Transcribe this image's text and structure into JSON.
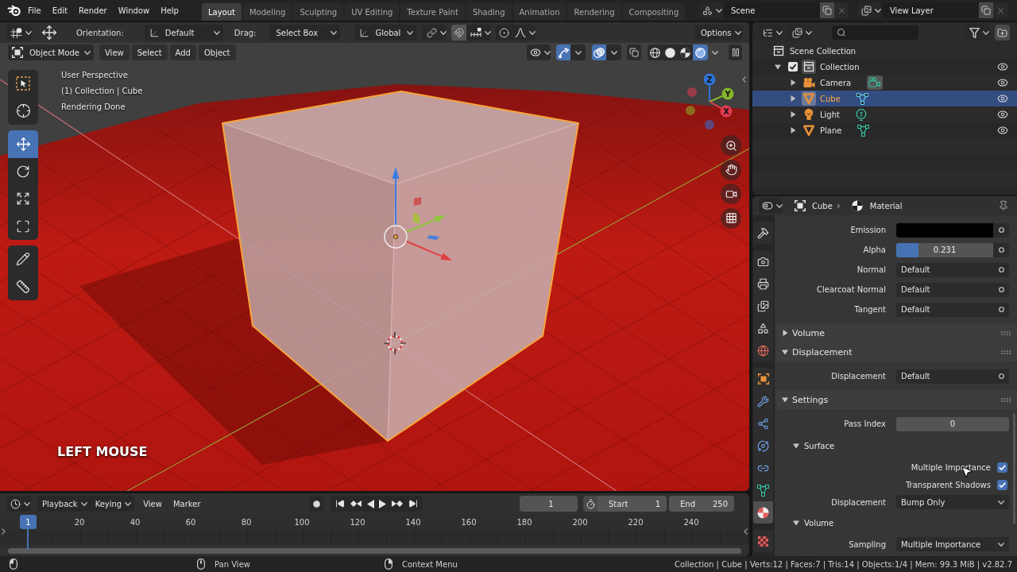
{
  "menubar": {
    "items": [
      "File",
      "Edit",
      "Render",
      "Window",
      "Help"
    ]
  },
  "workspaces": [
    {
      "label": "Layout",
      "selected": true
    },
    {
      "label": "Modeling",
      "selected": false
    },
    {
      "label": "Sculpting",
      "selected": false
    },
    {
      "label": "UV Editing",
      "selected": false
    },
    {
      "label": "Texture Paint",
      "selected": false
    },
    {
      "label": "Shading",
      "selected": false
    },
    {
      "label": "Animation",
      "selected": false
    },
    {
      "label": "Rendering",
      "selected": false
    },
    {
      "label": "Compositing",
      "selected": false
    }
  ],
  "scene": {
    "value": "Scene"
  },
  "view_layer": {
    "value": "View Layer"
  },
  "tool_header": {
    "orientation_label": "Orientation:",
    "orientation": "Default",
    "drag_label": "Drag:",
    "drag": "Select Box",
    "transform_orientation": "Global",
    "options": "Options"
  },
  "viewport_header": {
    "mode": "Object Mode",
    "menus": [
      "View",
      "Select",
      "Add",
      "Object"
    ],
    "gizmos_on": true,
    "overlays_on": true,
    "xray_on": false,
    "shading": [
      {
        "kind": "wireframe",
        "selected": false
      },
      {
        "kind": "solid",
        "selected": false
      },
      {
        "kind": "material",
        "selected": false
      },
      {
        "kind": "rendered",
        "selected": true
      }
    ]
  },
  "toolbar": [
    {
      "tools": [
        {
          "kind": "select_box",
          "selected": false
        },
        {
          "kind": "cursor",
          "selected": false
        }
      ]
    },
    {
      "tools": [
        {
          "kind": "move",
          "selected": true
        },
        {
          "kind": "rotate",
          "selected": false
        },
        {
          "kind": "scale",
          "selected": false
        },
        {
          "kind": "transform",
          "selected": false
        }
      ]
    },
    {
      "tools": [
        {
          "kind": "annotate",
          "selected": false
        },
        {
          "kind": "measure",
          "selected": false
        }
      ]
    }
  ],
  "viewport_info": [
    "User Perspective",
    "(1) Collection | Cube",
    "Rendering Done"
  ],
  "key_overlay": "LEFT MOUSE",
  "navigation_gizmo": {
    "axes": [
      {
        "label": "Z",
        "color": "#2f73d8"
      },
      {
        "label": "Y",
        "color": "#87b52c"
      },
      {
        "label": "X",
        "color": "#e23b4e"
      }
    ]
  },
  "timeline": {
    "menus": [
      {
        "label": "Playback",
        "kind": "dropdown"
      },
      {
        "label": "Keying",
        "kind": "dropdown"
      },
      {
        "label": "View",
        "kind": "menu"
      },
      {
        "label": "Marker",
        "kind": "menu"
      }
    ],
    "current_frame": "1",
    "start_label": "Start",
    "start": "1",
    "end_label": "End",
    "end": "250",
    "playhead": "1",
    "ruler": [
      "20",
      "40",
      "60",
      "80",
      "100",
      "120",
      "140",
      "160",
      "180",
      "200",
      "220",
      "240"
    ]
  },
  "outliner": {
    "tree": [
      {
        "label": "Scene Collection",
        "kind": "scene_collection",
        "selected": false,
        "children": [
          {
            "label": "Collection",
            "kind": "collection",
            "selected": false,
            "expanded": true,
            "checked": true,
            "visible": true,
            "children": [
              {
                "label": "Camera",
                "kind": "camera",
                "selected": false,
                "expanded": false,
                "visible": true
              },
              {
                "label": "Cube",
                "kind": "mesh",
                "selected": true,
                "expanded": false,
                "visible": true
              },
              {
                "label": "Light",
                "kind": "light",
                "selected": false,
                "expanded": false,
                "visible": true
              },
              {
                "label": "Plane",
                "kind": "mesh",
                "selected": false,
                "expanded": false,
                "visible": true
              }
            ]
          }
        ]
      }
    ]
  },
  "properties": {
    "object": "Cube",
    "context": "Material",
    "tab_groups": [
      {
        "tabs": [
          {
            "kind": "tool",
            "selected": false
          }
        ]
      },
      {
        "tabs": [
          {
            "kind": "render",
            "selected": false
          },
          {
            "kind": "output",
            "selected": false
          },
          {
            "kind": "view_layer",
            "selected": false
          },
          {
            "kind": "scene",
            "selected": false
          },
          {
            "kind": "world",
            "selected": false
          }
        ]
      },
      {
        "tabs": [
          {
            "kind": "object",
            "selected": false
          },
          {
            "kind": "modifiers",
            "selected": false
          },
          {
            "kind": "particles",
            "selected": false
          },
          {
            "kind": "physics",
            "selected": false
          },
          {
            "kind": "constraints",
            "selected": false
          },
          {
            "kind": "data",
            "selected": false
          },
          {
            "kind": "material",
            "selected": true
          }
        ]
      },
      {
        "tabs": [
          {
            "kind": "texture",
            "selected": false
          }
        ]
      }
    ],
    "rows": [
      {
        "kind": "color",
        "label": "Emission",
        "color": "#000000"
      },
      {
        "kind": "slider",
        "label": "Alpha",
        "value": "0.231",
        "level": 0.231
      },
      {
        "kind": "link",
        "label": "Normal",
        "value": "Default"
      },
      {
        "kind": "link",
        "label": "Clearcoat Normal",
        "value": "Default"
      },
      {
        "kind": "link",
        "label": "Tangent",
        "value": "Default"
      },
      {
        "kind": "panel",
        "label": "Volume",
        "expanded": false
      },
      {
        "kind": "panel",
        "label": "Displacement",
        "expanded": true
      },
      {
        "kind": "link",
        "label": "Displacement",
        "value": "Default"
      },
      {
        "kind": "panel",
        "label": "Settings",
        "expanded": true
      },
      {
        "kind": "number",
        "label": "Pass Index",
        "value": "0"
      },
      {
        "kind": "subpanel",
        "label": "Surface",
        "expanded": true
      },
      {
        "kind": "checkbox",
        "label": "Multiple Importance",
        "checked": true
      },
      {
        "kind": "checkbox",
        "label": "Transparent Shadows",
        "checked": true
      },
      {
        "kind": "dropdown",
        "label": "Displacement",
        "value": "Bump Only"
      },
      {
        "kind": "subpanel",
        "label": "Volume",
        "expanded": true
      },
      {
        "kind": "dropdown",
        "label": "Sampling",
        "value": "Multiple Importance"
      }
    ]
  },
  "status_bar": {
    "hints": [
      {
        "kind": "left"
      },
      {
        "kind": "middle",
        "label": "Pan View"
      },
      {
        "kind": "right",
        "label": "Context Menu"
      }
    ],
    "stats": "Collection | Cube | Verts:12 | Faces:7 | Tris:14 | Objects:1/4 | Mem: 99.3 MiB | v2.82.7"
  }
}
